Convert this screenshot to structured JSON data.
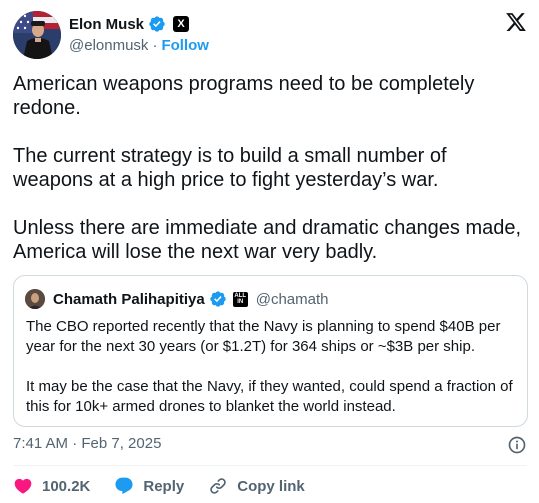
{
  "author": {
    "name": "Elon Musk",
    "handle": "@elonmusk",
    "separator": "·",
    "follow_label": "Follow",
    "affiliation_badge": "X"
  },
  "tweet": {
    "paragraphs": [
      "American weapons programs need to be completely redone.",
      "The current strategy is to build a small number of weapons at a high price to fight yesterday’s war.",
      "Unless there are immediate and dramatic changes made, America will lose the next war very badly."
    ],
    "timestamp": "7:41 AM · Feb 7, 2025"
  },
  "quoted": {
    "name": "Chamath Palihapitiya",
    "handle": "@chamath",
    "org_badge": "ALL IN",
    "paragraphs": [
      "The CBO reported recently that the Navy is planning to spend $40B per year for the next 30 years (or $1.2T) for 364 ships or ~$3B per ship.",
      "It may be the case that the Navy, if they wanted, could spend a fraction of this for 10k+ armed drones to blanket the world instead."
    ]
  },
  "actions": {
    "like_count": "100.2K",
    "reply_label": "Reply",
    "copy_link_label": "Copy link"
  },
  "icons": {
    "verified": "verified-badge-icon",
    "x_logo": "x-logo-icon",
    "info": "info-icon",
    "like": "heart-icon",
    "reply": "reply-bubble-icon",
    "link": "link-icon"
  },
  "colors": {
    "accent": "#1d9bf0",
    "like": "#f91880",
    "text": "#0f1419",
    "muted": "#536471",
    "border": "#cfd9de"
  }
}
